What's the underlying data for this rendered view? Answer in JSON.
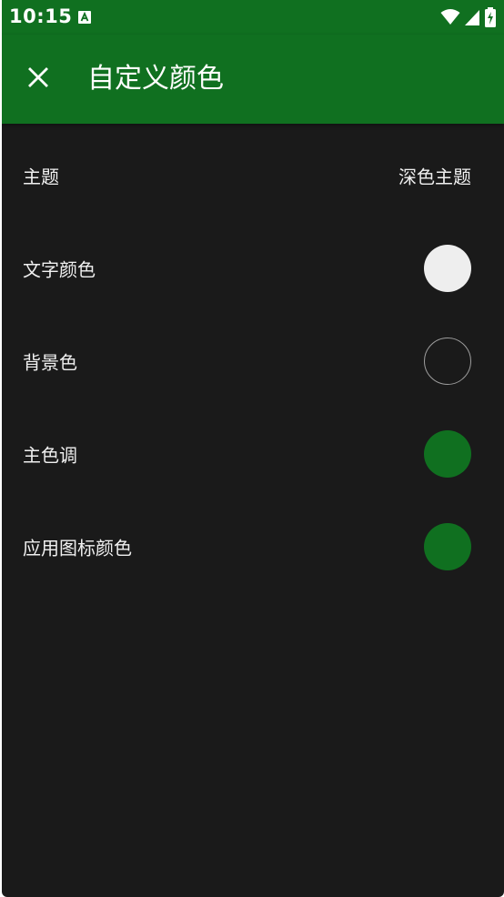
{
  "statusbar": {
    "time": "10:15",
    "icons": [
      "notification-a-icon",
      "wifi-icon",
      "signal-icon",
      "battery-charging-icon"
    ]
  },
  "appbar": {
    "title": "自定义颜色",
    "close_icon": "close-icon"
  },
  "settings": {
    "theme": {
      "label": "主题",
      "value": "深色主题"
    },
    "text_color": {
      "label": "文字颜色",
      "color": "#eeeeee"
    },
    "background_color": {
      "label": "背景色",
      "color": "#1a1a1a",
      "border": "#9e9e9e"
    },
    "primary_color": {
      "label": "主色调",
      "color": "#107020"
    },
    "app_icon_color": {
      "label": "应用图标颜色",
      "color": "#107020"
    }
  },
  "colors": {
    "accent": "#107020",
    "background": "#1a1a1a",
    "text": "#f0f0f0"
  }
}
